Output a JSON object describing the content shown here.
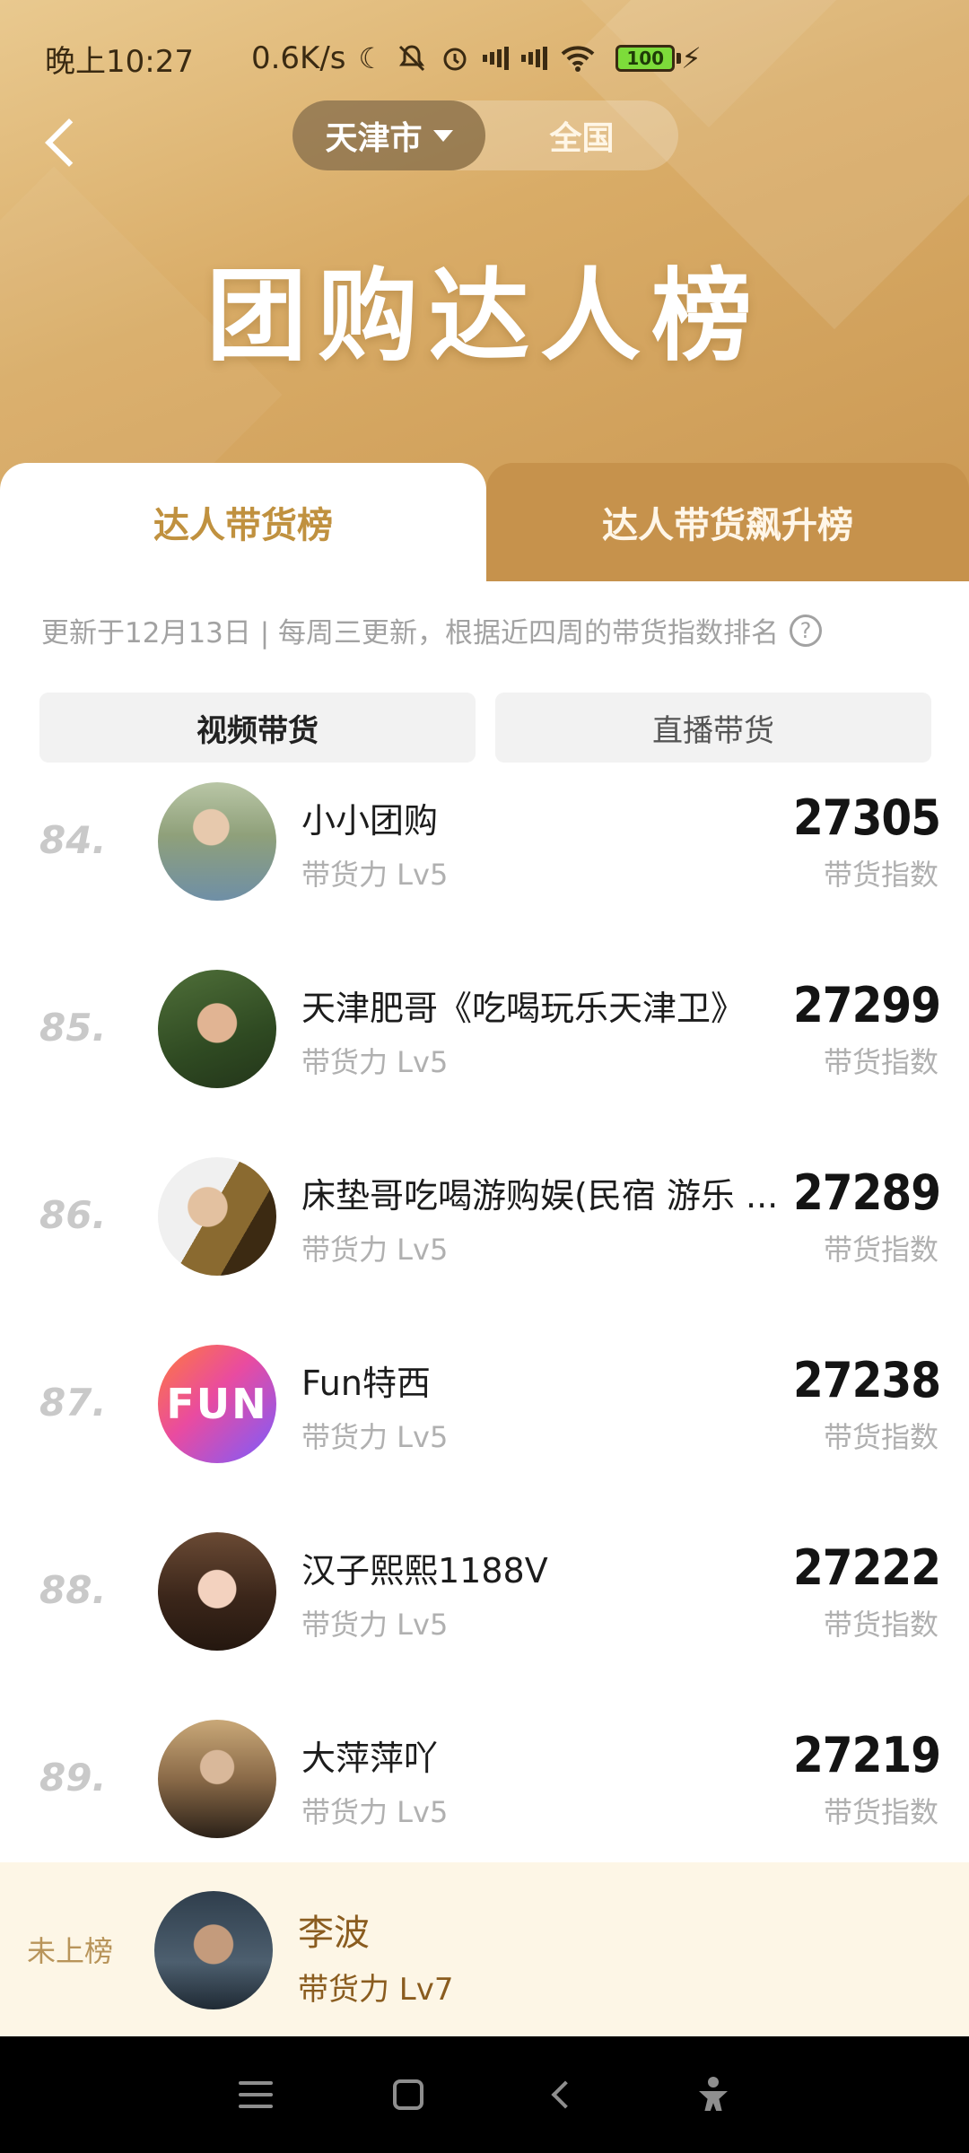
{
  "status_bar": {
    "time": "晚上10:27",
    "speed": "0.6K/s",
    "battery": "100",
    "icons": [
      "moon-icon",
      "mute-icon",
      "alarm-icon",
      "hd-signal-icon",
      "hd-signal-icon",
      "wifi-icon",
      "charging-icon"
    ]
  },
  "header": {
    "scope_city": "天津市",
    "scope_all": "全国",
    "title": "团购达人榜"
  },
  "tabs": {
    "primary": "达人带货榜",
    "secondary": "达人带货飙升榜"
  },
  "update_text": "更新于12月13日 | 每周三更新，根据近四周的带货指数排名",
  "subtabs": {
    "video": "视频带货",
    "live": "直播带货"
  },
  "list": [
    {
      "rank": "84.",
      "name": "小小团购",
      "level": "带货力 Lv5",
      "score": "27305",
      "score_label": "带货指数"
    },
    {
      "rank": "85.",
      "name": "天津肥哥《吃喝玩乐天津卫》",
      "level": "带货力 Lv5",
      "score": "27299",
      "score_label": "带货指数"
    },
    {
      "rank": "86.",
      "name": "床垫哥吃喝游购娱(民宿 游乐 ...",
      "level": "带货力 Lv5",
      "score": "27289",
      "score_label": "带货指数"
    },
    {
      "rank": "87.",
      "name": "Fun特西",
      "level": "带货力 Lv5",
      "score": "27238",
      "score_label": "带货指数",
      "avatar_text": "FUN"
    },
    {
      "rank": "88.",
      "name": "汉子熙熙1188V",
      "level": "带货力 Lv5",
      "score": "27222",
      "score_label": "带货指数"
    },
    {
      "rank": "89.",
      "name": "大萍萍吖",
      "level": "带货力 Lv5",
      "score": "27219",
      "score_label": "带货指数"
    }
  ],
  "me": {
    "status": "未上榜",
    "name": "李波",
    "level": "带货力 Lv7"
  },
  "colors": {
    "header_gold": "#d9ac67",
    "tab_active_text": "#c0913f",
    "me_background": "#fdf6e6"
  }
}
